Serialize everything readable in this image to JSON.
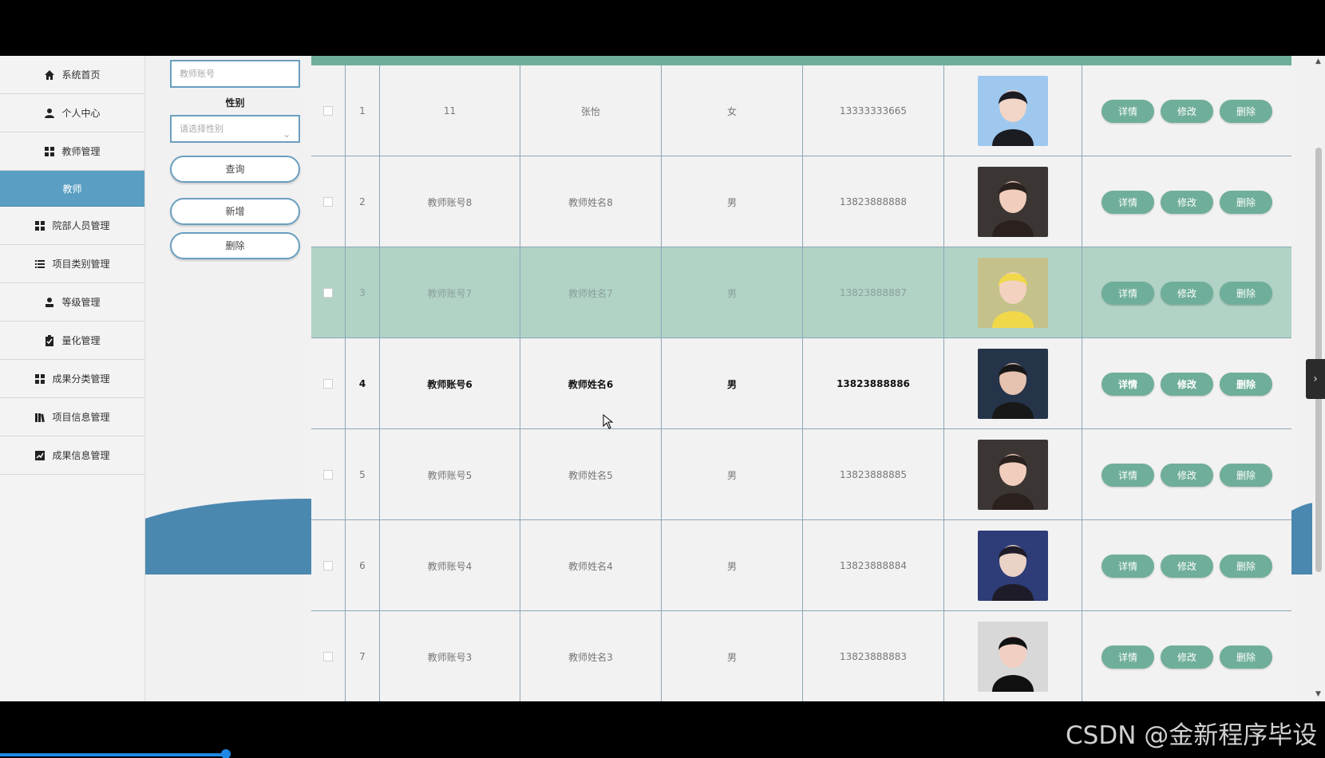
{
  "sidebar": {
    "items": [
      {
        "label": "系统首页",
        "icon": "home-icon"
      },
      {
        "label": "个人中心",
        "icon": "user-icon"
      },
      {
        "label": "教师管理",
        "icon": "grid-icon"
      },
      {
        "label": "院部人员管理",
        "icon": "grid-icon"
      },
      {
        "label": "项目类别管理",
        "icon": "list-icon"
      },
      {
        "label": "等级管理",
        "icon": "person-icon"
      },
      {
        "label": "量化管理",
        "icon": "clipboard-icon"
      },
      {
        "label": "成果分类管理",
        "icon": "grid-icon"
      },
      {
        "label": "项目信息管理",
        "icon": "book-icon"
      },
      {
        "label": "成果信息管理",
        "icon": "chart-icon"
      }
    ],
    "active_sub": "教师"
  },
  "search": {
    "account_placeholder": "教师账号",
    "gender_label": "性别",
    "gender_placeholder": "请选择性别",
    "query_button": "查询",
    "add_button": "新增",
    "delete_button": "删除"
  },
  "table": {
    "actions": {
      "detail": "详情",
      "edit": "修改",
      "delete": "删除"
    },
    "rows": [
      {
        "index": "1",
        "account": "11",
        "name": "张怡",
        "gender": "女",
        "phone": "13333333665",
        "photo": "avatar-1"
      },
      {
        "index": "2",
        "account": "教师账号8",
        "name": "教师姓名8",
        "gender": "男",
        "phone": "13823888888",
        "photo": "avatar-2"
      },
      {
        "index": "3",
        "account": "教师账号7",
        "name": "教师姓名7",
        "gender": "男",
        "phone": "13823888887",
        "photo": "avatar-3"
      },
      {
        "index": "4",
        "account": "教师账号6",
        "name": "教师姓名6",
        "gender": "男",
        "phone": "13823888886",
        "photo": "avatar-4"
      },
      {
        "index": "5",
        "account": "教师账号5",
        "name": "教师姓名5",
        "gender": "男",
        "phone": "13823888885",
        "photo": "avatar-5"
      },
      {
        "index": "6",
        "account": "教师账号4",
        "name": "教师姓名4",
        "gender": "男",
        "phone": "13823888884",
        "photo": "avatar-6"
      },
      {
        "index": "7",
        "account": "教师账号3",
        "name": "教师姓名3",
        "gender": "男",
        "phone": "13823888883",
        "photo": "avatar-7"
      }
    ]
  },
  "watermark": "CSDN @金新程序毕设",
  "colors": {
    "accent": "#6fae9a",
    "sidebar_active": "#5a9fc3",
    "wave": "#4a88b0"
  }
}
